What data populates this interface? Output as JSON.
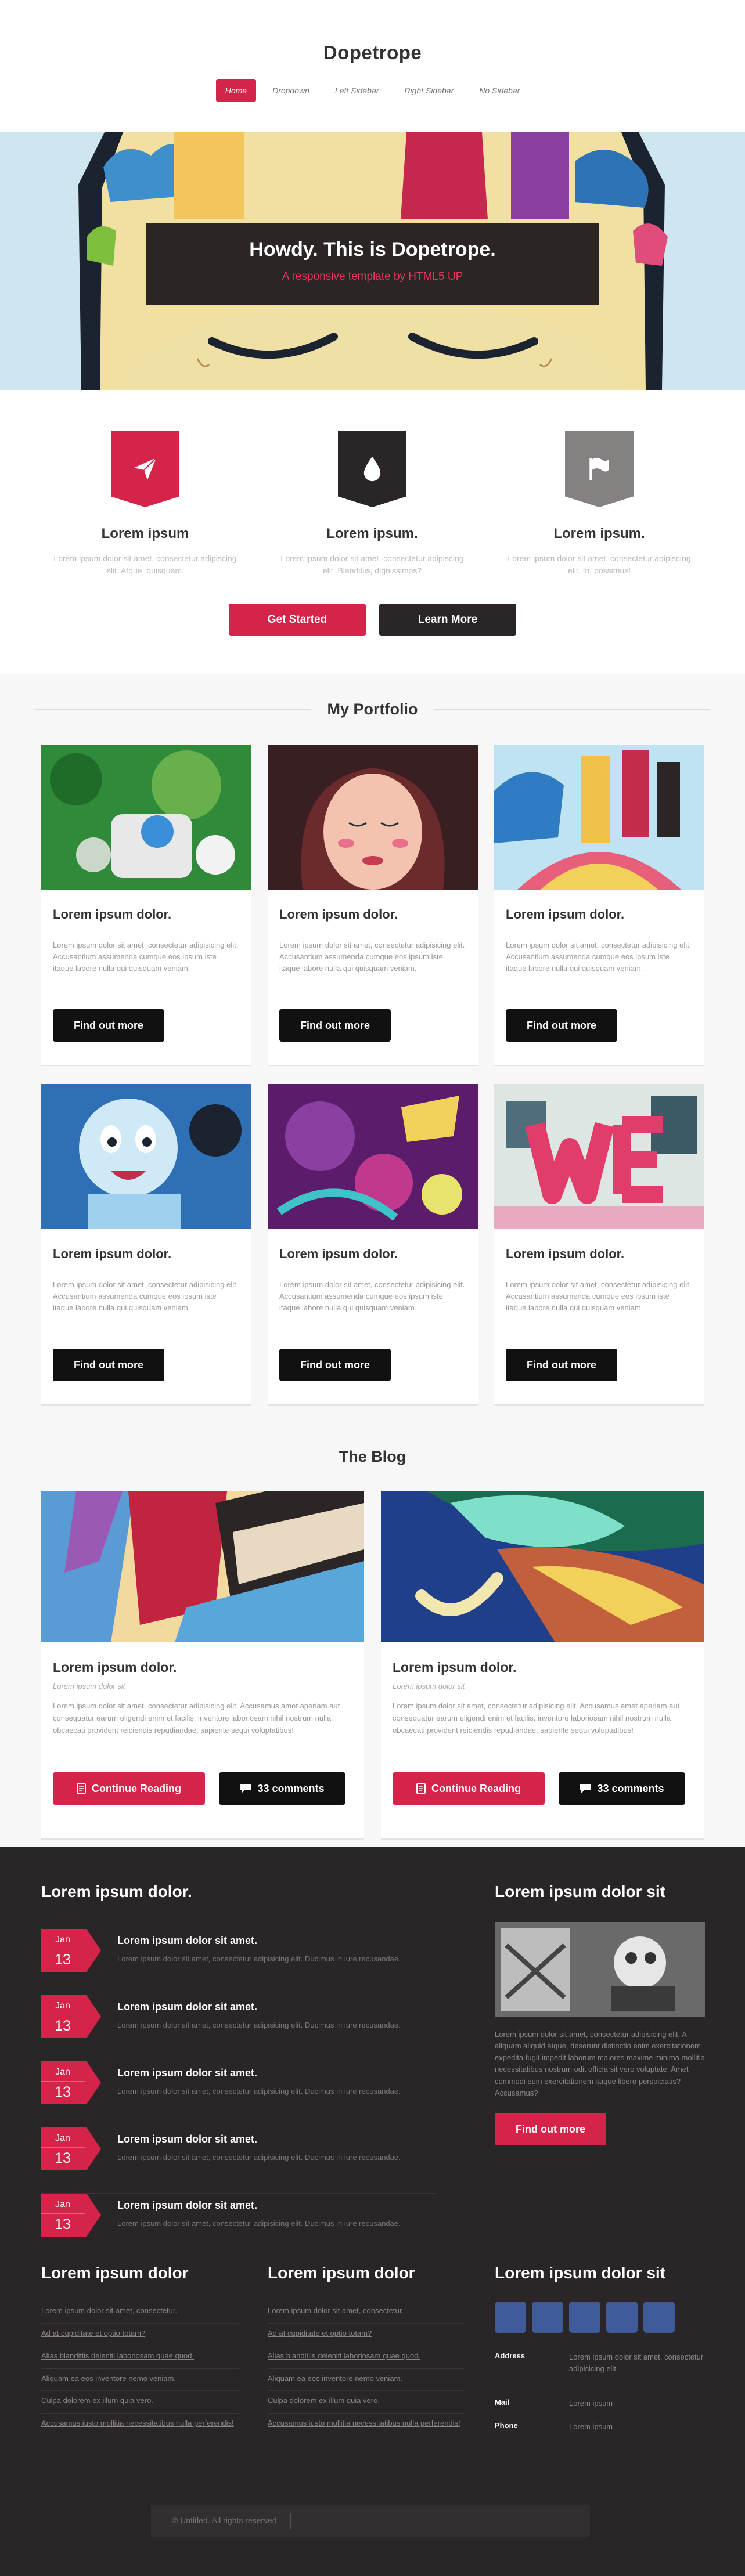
{
  "site": {
    "title": "Dopetrope"
  },
  "nav": [
    "Home",
    "Dropdown",
    "Left Sidebar",
    "Right Sidebar",
    "No Sidebar"
  ],
  "hero": {
    "title": "Howdy. This is Dopetrope.",
    "subtitle": "A responsive template by HTML5 UP"
  },
  "features": [
    {
      "title": "Lorem ipsum",
      "text": "Lorem ipsum dolor sit amet, consectetur adipiscing elit. Atque, quisquam.",
      "icon": "paper-plane-icon",
      "color": "#d52349"
    },
    {
      "title": "Lorem ipsum.",
      "text": "Lorem ipsum dolor sit amet, consectetur adipiscing elit. Blanditiis, dignissimos?",
      "icon": "drop-icon",
      "color": "#2a2627"
    },
    {
      "title": "Lorem ipsum.",
      "text": "Lorem ipsum dolor sit amet, consectetur adipiscing elit. In, possimus!",
      "icon": "flag-icon",
      "color": "#858181"
    }
  ],
  "cta": {
    "primary": "Get Started",
    "secondary": "Learn More"
  },
  "portfolio": {
    "title": "My Portfolio",
    "items": [
      {
        "title": "Lorem ipsum dolor.",
        "text": "Lorem ipsum dolor sit amet, consectetur adipisicing elit. Accusantium assumenda cumque eos ipsum iste itaque labore nulla qui quisquam veniam.",
        "button": "Find out more"
      },
      {
        "title": "Lorem ipsum dolor.",
        "text": "Lorem ipsum dolor sit amet, consectetur adipisicing elit. Accusantium assumenda cumque eos ipsum iste itaque labore nulla qui quisquam veniam.",
        "button": "Find out more"
      },
      {
        "title": "Lorem ipsum dolor.",
        "text": "Lorem ipsum dolor sit amet, consectetur adipisicing elit. Accusantium assumenda cumque eos ipsum iste itaque labore nulla qui quisquam veniam.",
        "button": "Find out more"
      },
      {
        "title": "Lorem ipsum dolor.",
        "text": "Lorem ipsum dolor sit amet, consectetur adipisicing elit. Accusantium assumenda cumque eos ipsum iste itaque labore nulla qui quisquam veniam.",
        "button": "Find out more"
      },
      {
        "title": "Lorem ipsum dolor.",
        "text": "Lorem ipsum dolor sit amet, consectetur adipisicing elit. Accusantium assumenda cumque eos ipsum iste itaque labore nulla qui quisquam veniam.",
        "button": "Find out more"
      },
      {
        "title": "Lorem ipsum dolor.",
        "text": "Lorem ipsum dolor sit amet, consectetur adipisicing elit. Accusantium assumenda cumque eos ipsum iste itaque labore nulla qui quisquam veniam.",
        "button": "Find out more"
      }
    ]
  },
  "blog": {
    "title": "The Blog",
    "posts": [
      {
        "title": "Lorem ipsum dolor.",
        "subtitle": "Lorem ipsum dolor sit",
        "text": "Lorem ipsum dolor sit amet, consectetur adipisicing elit. Accusamus amet aperiam aut consequatur earum eligendi enim et facilis, inventore laboriosam nihil nostrum nulla obcaecati provident reiciendis repudiandae, sapiente sequi voluptatibus!",
        "read": "Continue Reading",
        "comments": "33 comments"
      },
      {
        "title": "Lorem ipsum dolor.",
        "subtitle": "Lorem ipsum dolor sit",
        "text": "Lorem ipsum dolor sit amet, consectetur adipisicing elit. Accusamus amet aperiam aut consequatur earum eligendi enim et facilis, inventore laboriosam nihil nostrum nulla obcaecati provident reiciendis repudiandae, sapiente sequi voluptatibus!",
        "read": "Continue Reading",
        "comments": "33 comments"
      }
    ]
  },
  "footer": {
    "news_title": "Lorem ipsum dolor.",
    "news": [
      {
        "month": "Jan",
        "day": "13",
        "title": "Lorem ipsum dolor sit amet.",
        "text": "Lorem ipsum dolor sit amet, consectetur adipisicing elit. Ducimus in iure recusandae."
      },
      {
        "month": "Jan",
        "day": "13",
        "title": "Lorem ipsum dolor sit amet.",
        "text": "Lorem ipsum dolor sit amet, consectetur adipisicing elit. Ducimus in iure recusandae."
      },
      {
        "month": "Jan",
        "day": "13",
        "title": "Lorem ipsum dolor sit amet.",
        "text": "Lorem ipsum dolor sit amet, consectetur adipisicing elit. Ducimus in iure recusandae."
      },
      {
        "month": "Jan",
        "day": "13",
        "title": "Lorem ipsum dolor sit amet.",
        "text": "Lorem ipsum dolor sit amet, consectetur adipisicing elit. Ducimus in iure recusandae."
      },
      {
        "month": "Jan",
        "day": "13",
        "title": "Lorem ipsum dolor sit amet.",
        "text": "Lorem ipsum dolor sit amet, consectetur adipisicing elit. Ducimus in iure recusandae."
      }
    ],
    "side_title": "Lorem ipsum dolor sit",
    "side_text": "Lorem ipsum dolor sit amet, consectetur adipisicing elit. A aliquam aliquid atque, deserunt distinctio enim exercitationem expedita fugit impedit laborum maiores maxime minima mollitia necessitatibus nostrum odit officia sit vero voluptate. Amet commodi eum exercitationem itaque libero perspiciatis? Accusamus?",
    "side_button": "Find out more",
    "links_col1_title": "Lorem ipsum dolor",
    "links_col2_title": "Lorem ipsum dolor",
    "links": [
      "Lorem ipsum dolor sit amet, consectetur.",
      "Ad at cupiditate et optio totam?",
      "Alias blanditiis deleniti laboriosam quae quod.",
      "Aliquam ea eos inventore nemo veniam.",
      "Culpa dolorem ex illum quia vero.",
      "Accusamus iusto mollitia necessitatibus nulla perferendis!"
    ],
    "contact_title": "Lorem ipsum dolor sit",
    "contact": [
      {
        "label": "Address",
        "value": "Lorem ipsum dolor sit amet, consectetur adipisicing elit."
      },
      {
        "label": "Mail",
        "value": "Lorem ipsum"
      },
      {
        "label": "Phone",
        "value": "Lorem ipsum"
      }
    ],
    "copyright": "© Untitled. All rights reserved."
  },
  "colors": {
    "accent": "#d52349",
    "dark": "#2a2627",
    "social": "#3f5b9a"
  }
}
